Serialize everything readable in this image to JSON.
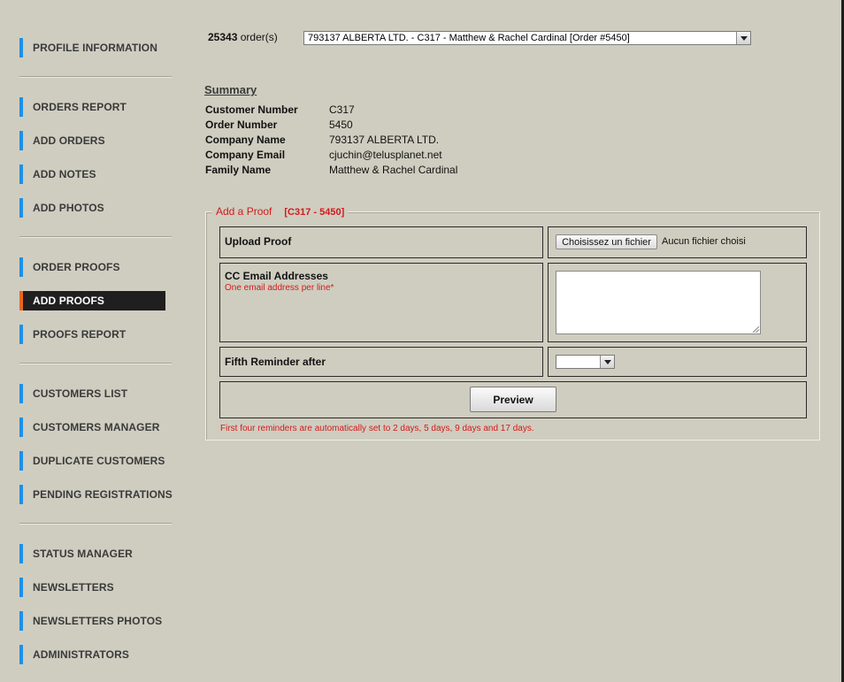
{
  "sidebar": {
    "profile": "PROFILE INFORMATION",
    "orders_report": "ORDERS REPORT",
    "add_orders": "ADD ORDERS",
    "add_notes": "ADD NOTES",
    "add_photos": "ADD PHOTOS",
    "order_proofs": "ORDER PROOFS",
    "add_proofs": "ADD PROOFS",
    "proofs_report": "PROOFS REPORT",
    "customers_list": "CUSTOMERS LIST",
    "customers_manager": "CUSTOMERS MANAGER",
    "duplicate_customers": "DUPLICATE CUSTOMERS",
    "pending_registrations": "PENDING REGISTRATIONS",
    "status_manager": "STATUS MANAGER",
    "newsletters": "NEWSLETTERS",
    "newsletters_photos": "NEWSLETTERS PHOTOS",
    "administrators": "ADMINISTRATORS",
    "active_item": "ADD PROOFS"
  },
  "orders": {
    "count": "25343",
    "count_suffix": "order(s)",
    "selected": "793137 ALBERTA LTD. - C317 - Matthew & Rachel Cardinal [Order #5450]"
  },
  "summary": {
    "title": "Summary",
    "customer_number_label": "Customer Number",
    "customer_number": "C317",
    "order_number_label": "Order Number",
    "order_number": "5450",
    "company_name_label": "Company Name",
    "company_name": "793137 ALBERTA LTD.",
    "company_email_label": "Company Email",
    "company_email": "cjuchin@telusplanet.net",
    "family_name_label": "Family Name",
    "family_name": "Matthew & Rachel Cardinal"
  },
  "proof_form": {
    "legend": "Add a Proof",
    "legend_ref": "[C317 - 5450]",
    "upload_label": "Upload Proof",
    "file_button": "Choisissez un fichier",
    "file_status": "Aucun fichier choisi",
    "cc_label": "CC Email Addresses",
    "cc_hint": "One email address per line*",
    "cc_value": "",
    "reminder_label": "Fifth Reminder after",
    "reminder_value": "",
    "preview_button": "Preview",
    "note": "First four reminders are automatically set to 2 days, 5 days, 9 days and 17 days."
  },
  "colors": {
    "background": "#cfcdc0",
    "nav_bar": "#1e90e8",
    "active_bar": "#e8651e",
    "active_bg": "#1f1f1f",
    "alert_red": "#d31a1a"
  }
}
